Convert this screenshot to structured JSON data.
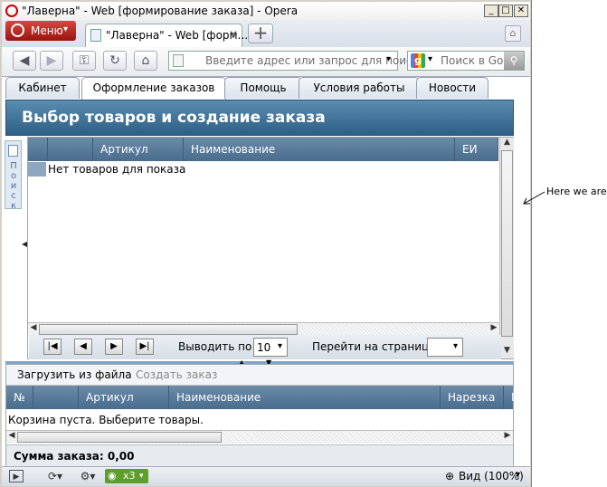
{
  "window": {
    "title": "\"Лаверна\" - Web [формирование заказа] - Opera"
  },
  "browser": {
    "menu_label": "Меню",
    "tab_title": "\"Лаверна\" - Web [форм...",
    "address_placeholder": "Введите адрес или запрос для поиска",
    "search_placeholder": "Поиск в Goog"
  },
  "app": {
    "tabs": [
      {
        "label": "Кабинет"
      },
      {
        "label": "Оформление заказов"
      },
      {
        "label": "Помощь"
      },
      {
        "label": "Условия работы"
      },
      {
        "label": "Новости"
      }
    ],
    "header_title": "Выбор товаров и создание заказа",
    "search_strip_label": "Поиск",
    "grid1": {
      "columns": [
        "",
        "Артикул",
        "Наименование",
        "ЕИ"
      ],
      "empty_text": "Нет товаров для показа"
    },
    "pager": {
      "per_page_label": "Выводить по",
      "per_page_value": "10",
      "goto_label": "Перейти на страницу",
      "goto_value": ""
    },
    "cart": {
      "load_button": "Загрузить из файла",
      "create_button": "Создать заказ",
      "columns": [
        "№",
        "",
        "Артикул",
        "Наименование",
        "Нарезка",
        "П"
      ],
      "empty_text": "Корзина пуста. Выберите товары.",
      "sum_text": "Сумма заказа: 0,00"
    }
  },
  "statusbar": {
    "turbo": "x3",
    "zoom": "Вид (100%)"
  },
  "annotation": {
    "text": "Here we are"
  }
}
